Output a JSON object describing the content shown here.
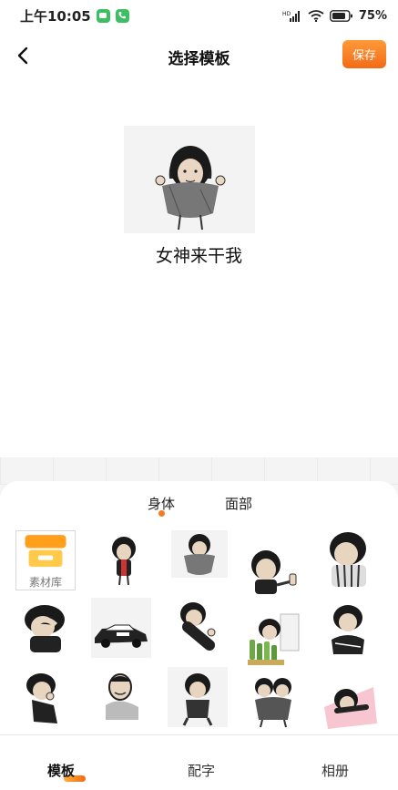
{
  "status_bar": {
    "time": "上午10:05",
    "battery": "75%",
    "network": "HD"
  },
  "header": {
    "title": "选择模板",
    "save_label": "保存"
  },
  "preview": {
    "caption": "女神来干我"
  },
  "tabs": [
    {
      "label": "身体",
      "active": true
    },
    {
      "label": "面部",
      "active": false
    }
  ],
  "material": {
    "label": "素材库"
  },
  "bottom_nav": [
    {
      "label": "模板",
      "active": true
    },
    {
      "label": "配字",
      "active": false
    },
    {
      "label": "相册",
      "active": false
    }
  ],
  "colors": {
    "accent": "#f47a22",
    "save_gradient_start": "#ff9a3a",
    "save_gradient_end": "#f26b16"
  }
}
